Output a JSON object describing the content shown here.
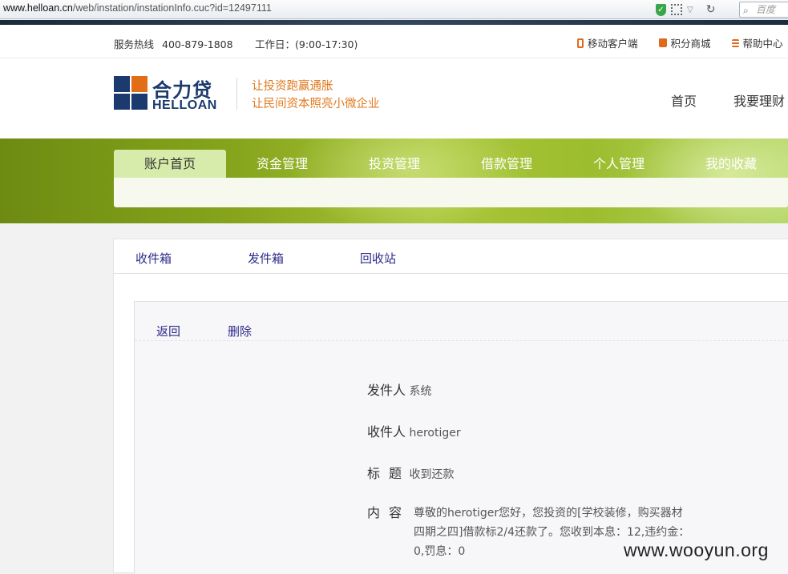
{
  "browser": {
    "url_host": "www.helloan.cn",
    "url_path": "/web/instation/instationInfo.cuc?id=12497111",
    "search_placeholder": "百度",
    "shield_glyph": "✓",
    "refresh_glyph": "↻",
    "search_glyph": "⌕",
    "dropdown_glyph": "▽"
  },
  "topbar": {
    "hotline_label": "服务热线",
    "hotline_number": "400-879-1808",
    "worktime": "工作日：(9:00-17:30)",
    "links": {
      "mobile": "移动客户端",
      "points": "积分商城",
      "help": "帮助中心"
    }
  },
  "header": {
    "logo_cn": "合力贷",
    "logo_en": "HELLOAN",
    "slogan_line1": "让投资跑赢通胀",
    "slogan_line2": "让民间资本照亮小微企业",
    "nav": {
      "home": "首页",
      "invest": "我要理财"
    }
  },
  "tabs": {
    "account_home": "账户首页",
    "funds": "资金管理",
    "investment": "投资管理",
    "loans": "借款管理",
    "personal": "个人管理",
    "favorites": "我的收藏"
  },
  "mailbox": {
    "inbox": "收件箱",
    "outbox": "发件箱",
    "trash": "回收站",
    "back": "返回",
    "delete": "删除"
  },
  "message": {
    "sender_label": "发件人",
    "sender": "系统",
    "receiver_label": "收件人",
    "receiver": "herotiger",
    "title_label": "标题",
    "title": "收到还款",
    "content_label": "内容",
    "content": "尊敬的herotiger您好，您投资的[学校装修，购买器材四期之四]借款标2/4还款了。您收到本息：12,违约金：0,罚息：0"
  },
  "watermark": "www.wooyun.org",
  "colors": {
    "brand_navy": "#1b3a6e",
    "brand_orange": "#e36c17",
    "banner_green": "#86a51c",
    "active_tab": "#d7ecaa",
    "link_purple": "#2d2b8a"
  }
}
